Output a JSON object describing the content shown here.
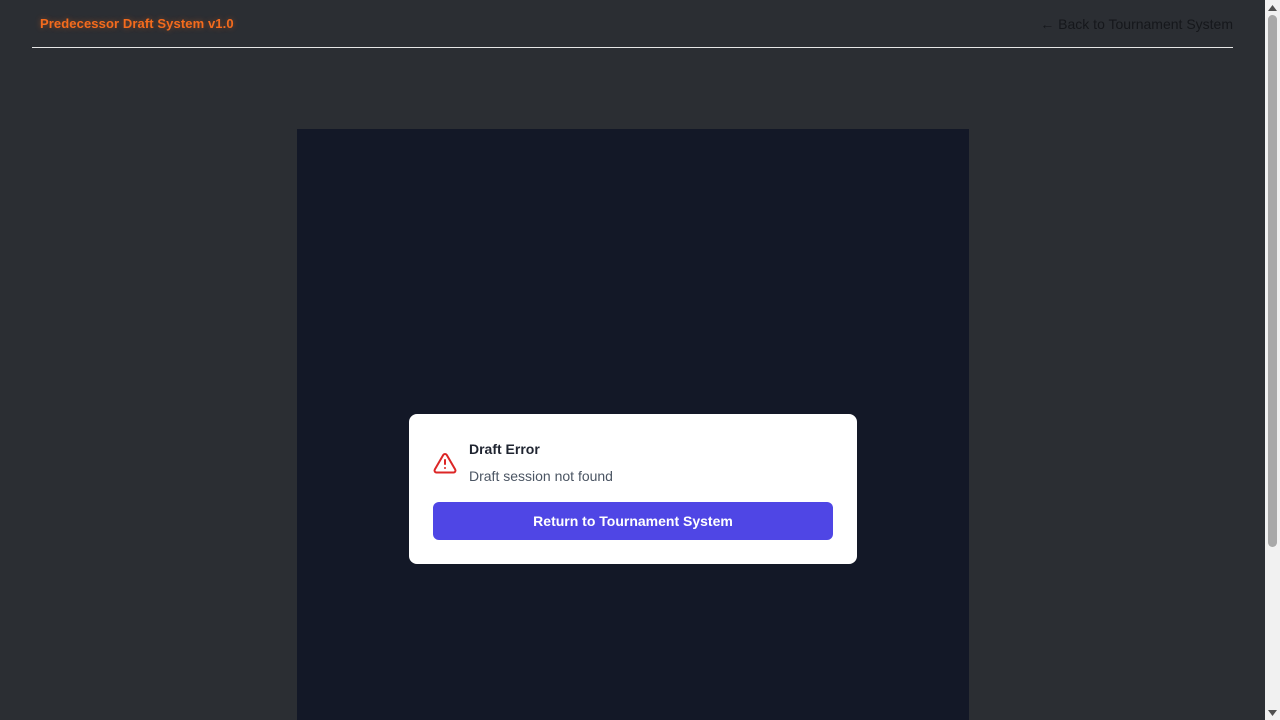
{
  "header": {
    "brand": "Predecessor Draft System v1.0",
    "back_link": "← Back to Tournament System"
  },
  "modal": {
    "icon": "warning-triangle-icon",
    "title": "Draft Error",
    "message": "Draft session not found",
    "button_label": "Return to Tournament System"
  },
  "colors": {
    "page_bg": "#2b2e33",
    "stage_bg": "#131827",
    "brand": "#f46b1d",
    "button": "#4f46e5",
    "error_icon": "#dc2626"
  }
}
